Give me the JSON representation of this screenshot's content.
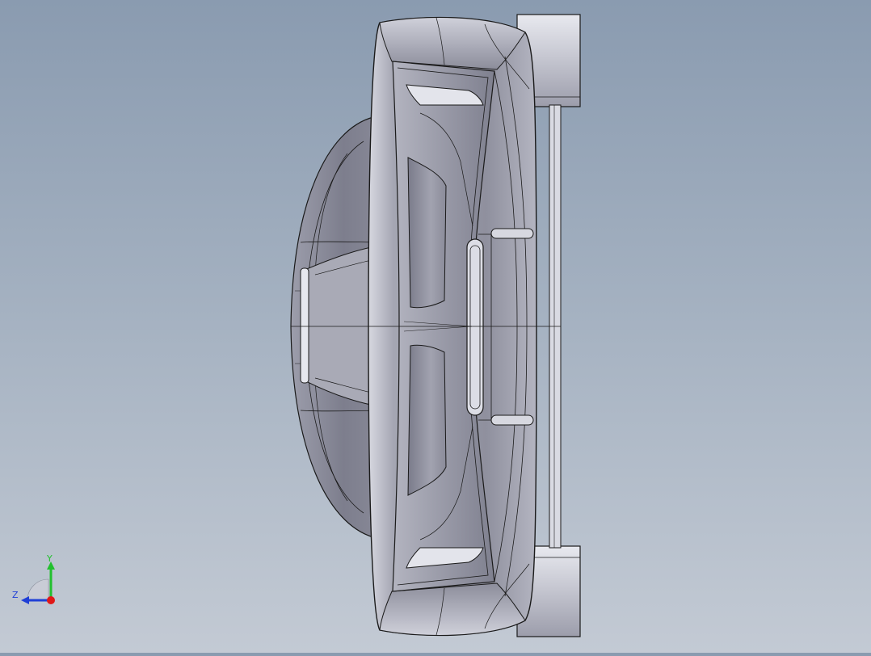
{
  "viewport": {
    "background_top": "#8a9bb0",
    "background_bottom": "#c3cad4",
    "model": {
      "name": "fan-housing-model",
      "shade_color": "#8d8e9c",
      "light_color": "#d8d9e2",
      "edge_color": "#1a1a1a"
    }
  },
  "triad": {
    "y_label": "Y",
    "z_label": "Z",
    "y_color": "#22c02e",
    "z_color": "#1f3fd6",
    "x_color": "#e01818"
  }
}
